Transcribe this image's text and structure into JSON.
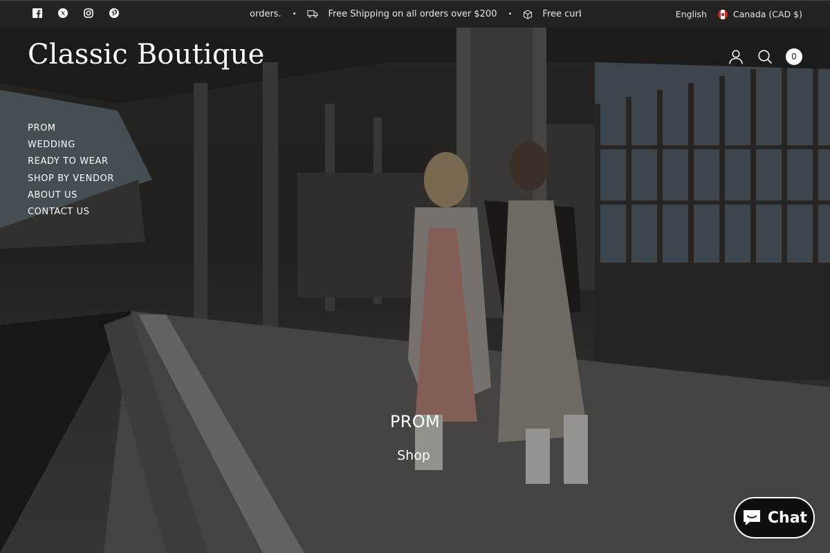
{
  "social": {
    "icons": [
      "facebook-icon",
      "x-twitter-icon",
      "instagram-icon",
      "pinterest-icon"
    ]
  },
  "announcement": {
    "fragment_start": "orders.",
    "shipping": "Free Shipping on all orders over $200",
    "fragment_end": "Free curbside ,",
    "separator": "•"
  },
  "locale": {
    "language": "English",
    "country": "Canada (CAD $)"
  },
  "header": {
    "logo": "Classic Boutique",
    "cart_count": "0"
  },
  "nav": {
    "items": [
      "PROM",
      "WEDDING",
      "READY TO WEAR",
      "SHOP BY VENDOR",
      "ABOUT US",
      "CONTACT US"
    ]
  },
  "hero": {
    "title": "PROM",
    "link": "Shop"
  },
  "chat": {
    "label": "Chat",
    "background": "#0e0e0e"
  }
}
